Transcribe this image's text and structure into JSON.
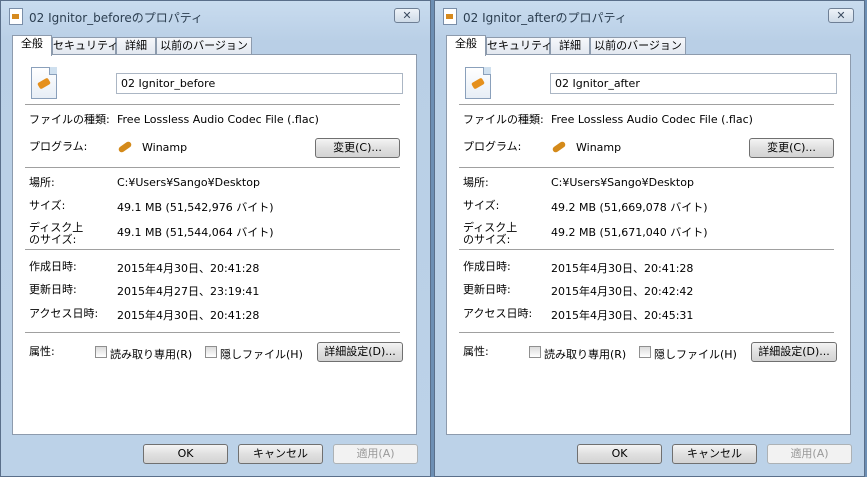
{
  "dialogs": [
    {
      "title": "02 Ignitor_beforeのプロパティ",
      "close": "✕",
      "tabs": [
        "全般",
        "セキュリティ",
        "詳細",
        "以前のバージョン"
      ],
      "name": "02 Ignitor_before",
      "type_label": "ファイルの種類:",
      "type_value": "Free Lossless Audio Codec File (.flac)",
      "program_label": "プログラム:",
      "program_value": "Winamp",
      "change_button": "変更(C)...",
      "location_label": "場所:",
      "location_value": "C:¥Users¥Sango¥Desktop",
      "size_label": "サイズ:",
      "size_value": "49.1 MB (51,542,976 バイト)",
      "disk_label_1": "ディスク上",
      "disk_label_2": "のサイズ:",
      "disk_value": "49.1 MB (51,544,064 バイト)",
      "created_label": "作成日時:",
      "created_value": "2015年4月30日、20:41:28",
      "modified_label": "更新日時:",
      "modified_value": "2015年4月27日、23:19:41",
      "accessed_label": "アクセス日時:",
      "accessed_value": "2015年4月30日、20:41:28",
      "attr_label": "属性:",
      "readonly_label": "読み取り専用(R)",
      "hidden_label": "隠しファイル(H)",
      "advanced_button": "詳細設定(D)...",
      "ok_button": "OK",
      "cancel_button": "キャンセル",
      "apply_button": "適用(A)"
    },
    {
      "title": "02 Ignitor_afterのプロパティ",
      "close": "✕",
      "tabs": [
        "全般",
        "セキュリティ",
        "詳細",
        "以前のバージョン"
      ],
      "name": "02 Ignitor_after",
      "type_label": "ファイルの種類:",
      "type_value": "Free Lossless Audio Codec File (.flac)",
      "program_label": "プログラム:",
      "program_value": "Winamp",
      "change_button": "変更(C)...",
      "location_label": "場所:",
      "location_value": "C:¥Users¥Sango¥Desktop",
      "size_label": "サイズ:",
      "size_value": "49.2 MB (51,669,078 バイト)",
      "disk_label_1": "ディスク上",
      "disk_label_2": "のサイズ:",
      "disk_value": "49.2 MB (51,671,040 バイト)",
      "created_label": "作成日時:",
      "created_value": "2015年4月30日、20:41:28",
      "modified_label": "更新日時:",
      "modified_value": "2015年4月30日、20:42:42",
      "accessed_label": "アクセス日時:",
      "accessed_value": "2015年4月30日、20:45:31",
      "attr_label": "属性:",
      "readonly_label": "読み取り専用(R)",
      "hidden_label": "隠しファイル(H)",
      "advanced_button": "詳細設定(D)...",
      "ok_button": "OK",
      "cancel_button": "キャンセル",
      "apply_button": "適用(A)"
    }
  ]
}
